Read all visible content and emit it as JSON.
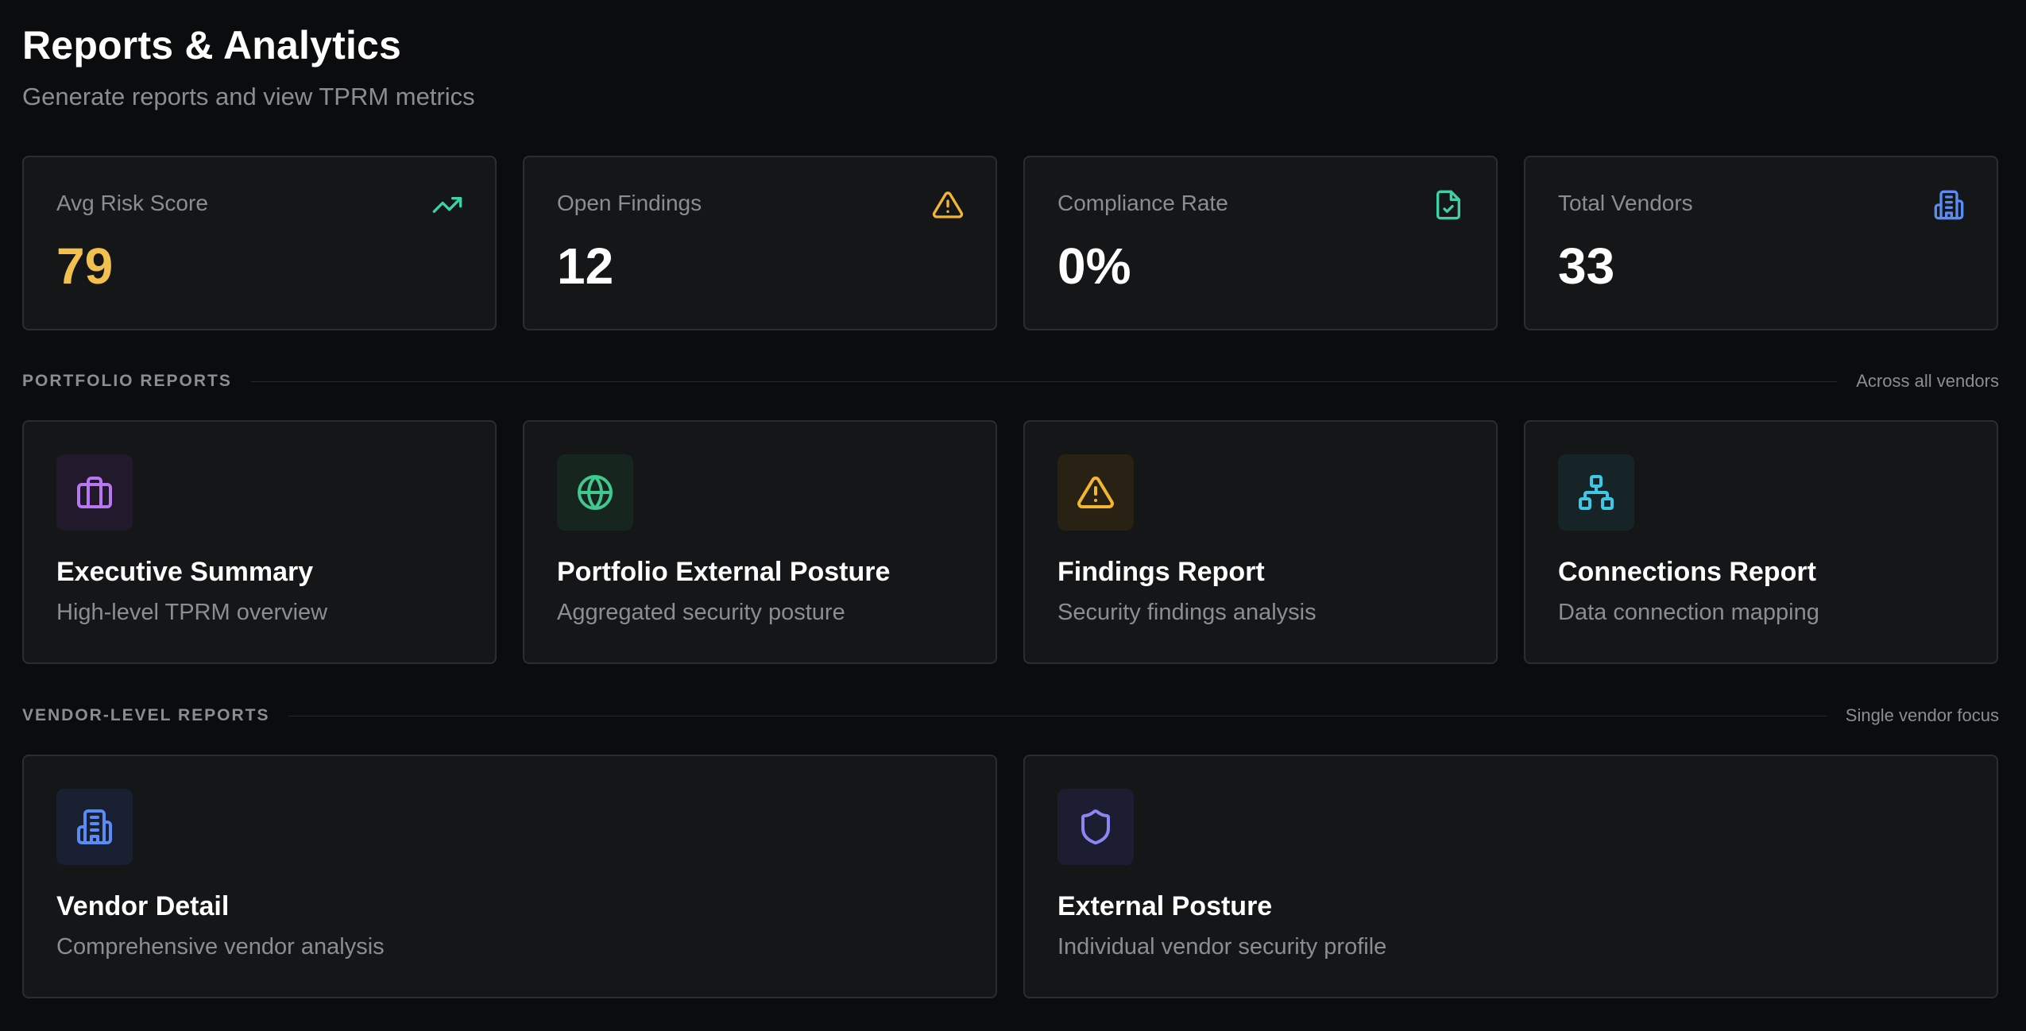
{
  "header": {
    "title": "Reports & Analytics",
    "subtitle": "Generate reports and view TPRM metrics"
  },
  "stats": [
    {
      "label": "Avg Risk Score",
      "value": "79",
      "icon": "trending-up-icon",
      "color": "#f2c04e",
      "icon_color": "#3fd1a6"
    },
    {
      "label": "Open Findings",
      "value": "12",
      "icon": "warning-icon",
      "color": "#ffffff",
      "icon_color": "#f2b630"
    },
    {
      "label": "Compliance Rate",
      "value": "0%",
      "icon": "file-check-icon",
      "color": "#ffffff",
      "icon_color": "#3fd1a6"
    },
    {
      "label": "Total Vendors",
      "value": "33",
      "icon": "building-icon",
      "color": "#ffffff",
      "icon_color": "#5b8cf5"
    }
  ],
  "portfolio": {
    "title": "PORTFOLIO REPORTS",
    "note": "Across all vendors",
    "reports": [
      {
        "title": "Executive Summary",
        "description": "High-level TPRM overview",
        "icon": "briefcase-icon",
        "icon_color": "#b877f0",
        "icon_bg": "#221a2c"
      },
      {
        "title": "Portfolio External Posture",
        "description": "Aggregated security posture",
        "icon": "globe-icon",
        "icon_color": "#3fc98f",
        "icon_bg": "#17251f"
      },
      {
        "title": "Findings Report",
        "description": "Security findings analysis",
        "icon": "warning-icon",
        "icon_color": "#f2b630",
        "icon_bg": "#2a2115"
      },
      {
        "title": "Connections Report",
        "description": "Data connection mapping",
        "icon": "network-icon",
        "icon_color": "#3ec8e8",
        "icon_bg": "#162428"
      }
    ]
  },
  "vendor_level": {
    "title": "VENDOR-LEVEL REPORTS",
    "note": "Single vendor focus",
    "reports": [
      {
        "title": "Vendor Detail",
        "description": "Comprehensive vendor analysis",
        "icon": "building-icon",
        "icon_color": "#5b8cf5",
        "icon_bg": "#182031"
      },
      {
        "title": "External Posture",
        "description": "Individual vendor security profile",
        "icon": "shield-icon",
        "icon_color": "#8c86f5",
        "icon_bg": "#1d1d31"
      }
    ]
  }
}
